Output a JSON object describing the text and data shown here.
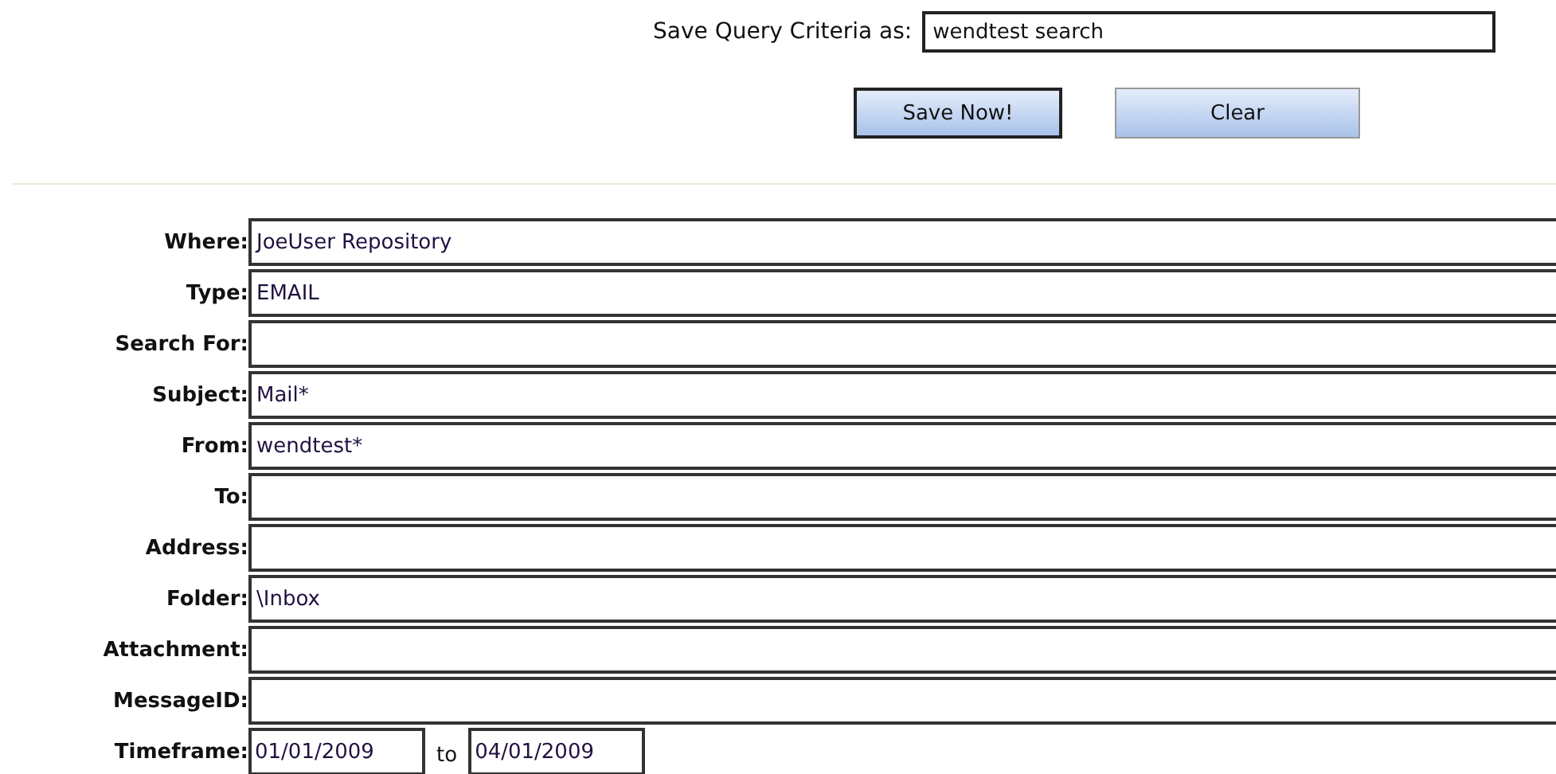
{
  "save_query": {
    "label": "Save Query Criteria as:",
    "value": "wendtest search"
  },
  "buttons": [
    {
      "label": "Save Now!",
      "kind": "default"
    },
    {
      "label": "Clear",
      "kind": "plain"
    }
  ],
  "fields": [
    {
      "label": "Where:",
      "value": "JoeUser Repository"
    },
    {
      "label": "Type:",
      "value": "EMAIL"
    },
    {
      "label": "Search For:"
    },
    {
      "label": "Subject:",
      "value": "Mail*"
    },
    {
      "label": "From:",
      "value": "wendtest*"
    },
    {
      "label": "To:"
    },
    {
      "label": "Address:"
    },
    {
      "label": "Folder:",
      "value": "\\Inbox"
    },
    {
      "label": "Attachment:"
    },
    {
      "label": "MessageID:"
    }
  ],
  "timeframe": {
    "label": "Timeframe:",
    "from": "01/01/2009",
    "separator": "to",
    "to": "04/01/2009"
  }
}
